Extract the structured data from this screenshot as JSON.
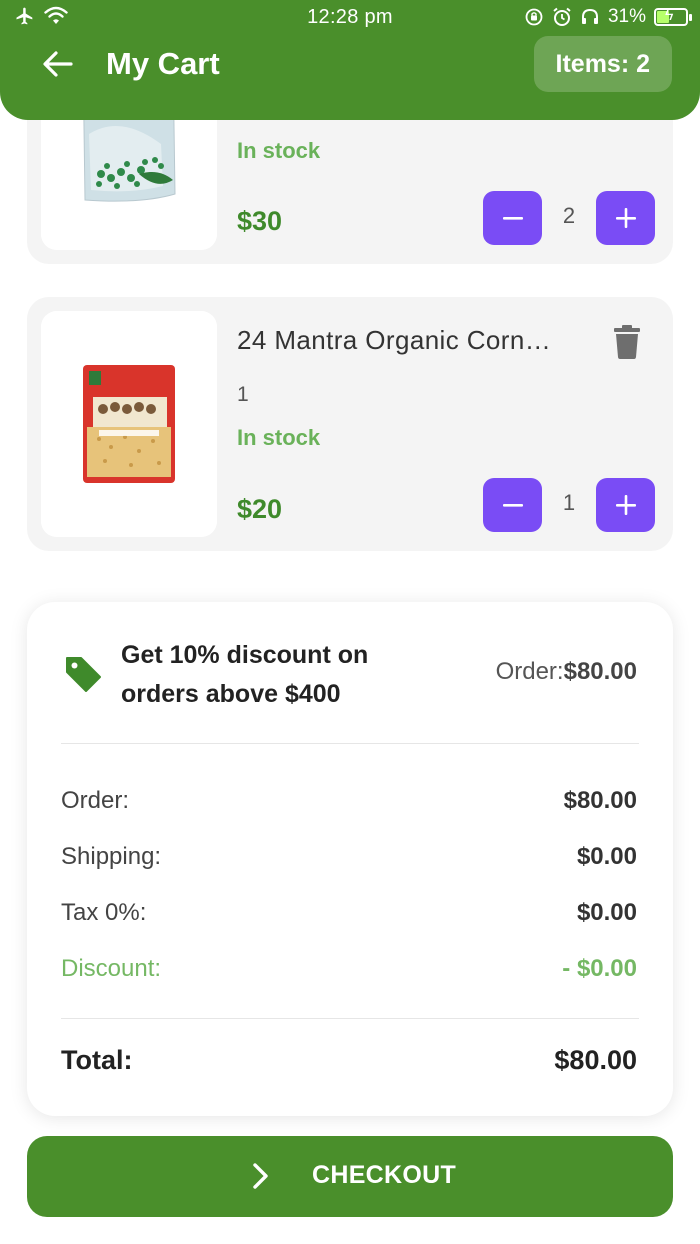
{
  "status_bar": {
    "time": "12:28 pm",
    "battery_percent": "31%",
    "battery_level": 0.31,
    "icons_left": [
      "airplane-icon",
      "wifi-icon"
    ],
    "icons_right": [
      "screen-rotation-lock-icon",
      "alarm-icon",
      "headphones-icon",
      "battery-charging-icon"
    ]
  },
  "header": {
    "title": "My Cart",
    "items_badge": "Items: 2",
    "back_icon": "arrow-left-icon",
    "color": "#4a8f2b"
  },
  "cart": {
    "items": [
      {
        "name": "",
        "stock": "In stock",
        "price": "$30",
        "quantity": "2",
        "image": "frozen-green-peas-pack"
      },
      {
        "name": "24 Mantra Organic Corn…",
        "quantity_text": "1",
        "stock": "In stock",
        "price": "$20",
        "quantity": "1",
        "image": "organic-corn-rava-pack"
      }
    ],
    "stepper_color": "#7a4cf5",
    "stock_color": "#6ab25a",
    "price_color": "#3f8a2b"
  },
  "summary": {
    "promo_text": "Get 10% discount on orders above $400",
    "promo_order_label": "Order:",
    "promo_order_value": "$80.00",
    "rows": {
      "order_label": "Order:",
      "order_value": "$80.00",
      "shipping_label": "Shipping:",
      "shipping_value": "$0.00",
      "tax_label": "Tax 0%:",
      "tax_value": "$0.00",
      "discount_label": "Discount:",
      "discount_value": "- $0.00",
      "total_label": "Total:",
      "total_value": "$80.00"
    },
    "discount_color": "#75b864"
  },
  "checkout": {
    "label": "CHECKOUT",
    "icon": "chevron-right-icon"
  }
}
